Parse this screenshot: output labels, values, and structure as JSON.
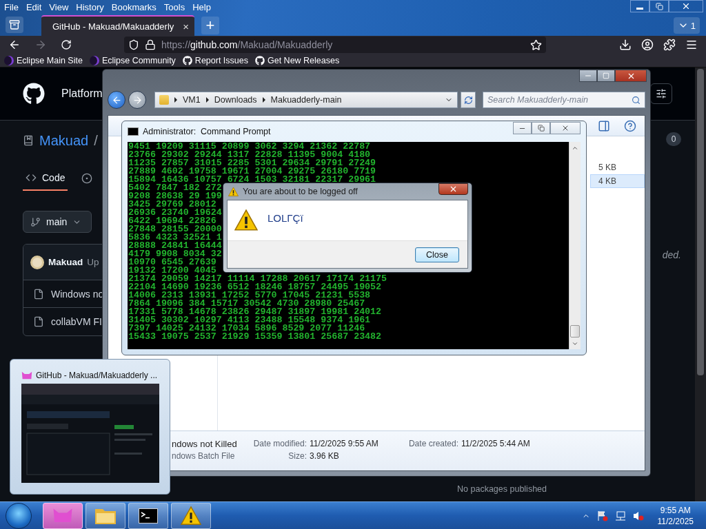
{
  "browser": {
    "menu": [
      "File",
      "Edit",
      "View",
      "History",
      "Bookmarks",
      "Tools",
      "Help"
    ],
    "tab": {
      "title": "GitHub - Makuad/Makuadderly",
      "close": "×",
      "selected": true
    },
    "new_tab": "+",
    "tab_count": "1",
    "url": {
      "scheme": "https://",
      "host": "github.com",
      "path": "/Makuad/Makuadderly"
    },
    "bookmarks": [
      {
        "label": "Eclipse Main Site",
        "kind": "eclipse"
      },
      {
        "label": "Eclipse Community",
        "kind": "eclipse"
      },
      {
        "label": "Report Issues",
        "kind": "github"
      },
      {
        "label": "Get New Releases",
        "kind": "github"
      }
    ]
  },
  "github": {
    "nav": "Platform",
    "owner": "Makuad",
    "separator": "/",
    "counter": "0",
    "repo_tabs": [
      {
        "label": "Code",
        "selected": true
      }
    ],
    "branch": "main",
    "commit_author": "Makuad",
    "commit_message": "Up",
    "files": [
      "Windows no",
      "collabVM FI"
    ],
    "about_tail": "ded.",
    "packages": "No packages published"
  },
  "explorer": {
    "path": [
      "VM1",
      "Downloads",
      "Makuadderly-main"
    ],
    "search_placeholder": "Search Makuadderly-main",
    "sizes": [
      {
        "text": "5 KB",
        "selected": false
      },
      {
        "text": "4 KB",
        "selected": true
      }
    ],
    "details": {
      "name": "ndows not Killed",
      "type": "ndows Batch File",
      "modified_label": "Date modified:",
      "modified": "11/2/2025 9:55 AM",
      "created_label": "Date created:",
      "created": "11/2/2025 5:44 AM",
      "size_label": "Size:",
      "size": "3.96 KB"
    }
  },
  "console": {
    "title": "Administrator:  Command Prompt",
    "lines": [
      "9451 19209 31115 20899 3062 3294 21362 22787",
      "23766 29302 29244 1317 22828 11395 9004 4180",
      "11235 27857 31015 2285 5301 29634 29791 27249",
      "27889 4602 19758 19671 27004 29275 26180 7719",
      "15894 16436 10757 6724 1503 32181 22317 29961",
      "5402 7847 182 272",
      "9208 28638 29 199",
      "3425 29769 28012",
      "26936 23740 19624",
      "6422 19694 22826",
      "27848 28155 20000",
      "5836 4323 32521 1",
      "28888 24841 16444",
      "4179 9908 8034 32",
      "10970 6545 27639",
      "19132 17200 4045",
      "21374 29059 14217 11114 17288 20617 17174 21175",
      "22104 14690 19236 6512 18246 18757 24495 19052",
      "14006 2313 13931 17252 5770 17045 21231 5538",
      "7864 19096 384 15717 30542 4730 28980 25467",
      "17331 5778 14678 23826 29487 31897 19981 24012",
      "31405 30302 10297 4113 23488 15548 9374 1961",
      "7397 14025 24132 17034 5896 8529 2077 11246",
      "15433 19075 2537 21929 15359 13801 25687 23482"
    ]
  },
  "dialog": {
    "title": "You are about to be logged off",
    "message": "LOLΓÇï",
    "button": "Close"
  },
  "preview": {
    "title": "GitHub - Makuad/Makuadderly ..."
  },
  "taskbar": {
    "items": [
      {
        "kind": "browser",
        "selected": true
      },
      {
        "kind": "folder",
        "selected": false
      },
      {
        "kind": "console",
        "selected": false
      },
      {
        "kind": "warning",
        "selected": false
      }
    ],
    "time": "9:55 AM",
    "date": "11/2/2025"
  }
}
